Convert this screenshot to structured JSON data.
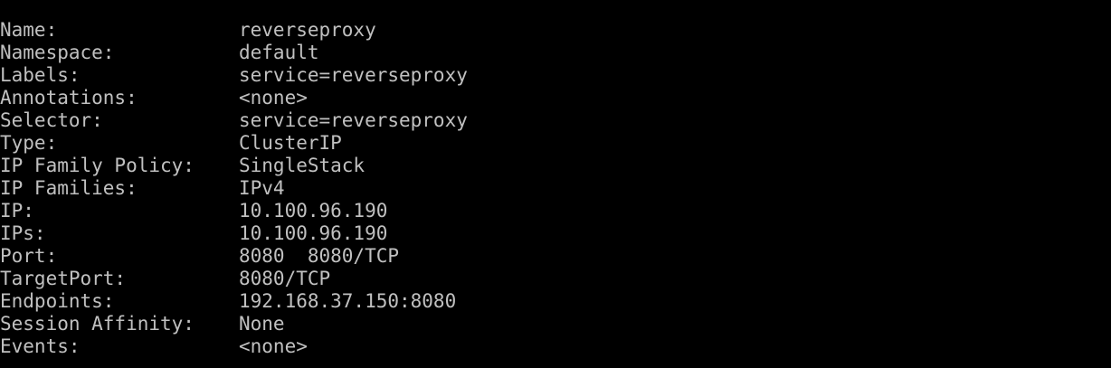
{
  "terminal": {
    "colors": {
      "background": "#000000",
      "text": "#c0c0c0"
    },
    "lines": [
      {
        "key": "Name:",
        "value": "reverseproxy"
      },
      {
        "key": "Namespace:",
        "value": "default"
      },
      {
        "key": "Labels:",
        "value": "service=reverseproxy"
      },
      {
        "key": "Annotations:",
        "value": "<none>"
      },
      {
        "key": "Selector:",
        "value": "service=reverseproxy"
      },
      {
        "key": "Type:",
        "value": "ClusterIP"
      },
      {
        "key": "IP Family Policy:",
        "value": "SingleStack"
      },
      {
        "key": "IP Families:",
        "value": "IPv4"
      },
      {
        "key": "IP:",
        "value": "10.100.96.190"
      },
      {
        "key": "IPs:",
        "value": "10.100.96.190"
      },
      {
        "key": "Port:",
        "value": "8080  8080/TCP"
      },
      {
        "key": "TargetPort:",
        "value": "8080/TCP"
      },
      {
        "key": "Endpoints:",
        "value": "192.168.37.150:8080"
      },
      {
        "key": "Session Affinity:",
        "value": "None"
      },
      {
        "key": "Events:",
        "value": "<none>"
      }
    ]
  }
}
